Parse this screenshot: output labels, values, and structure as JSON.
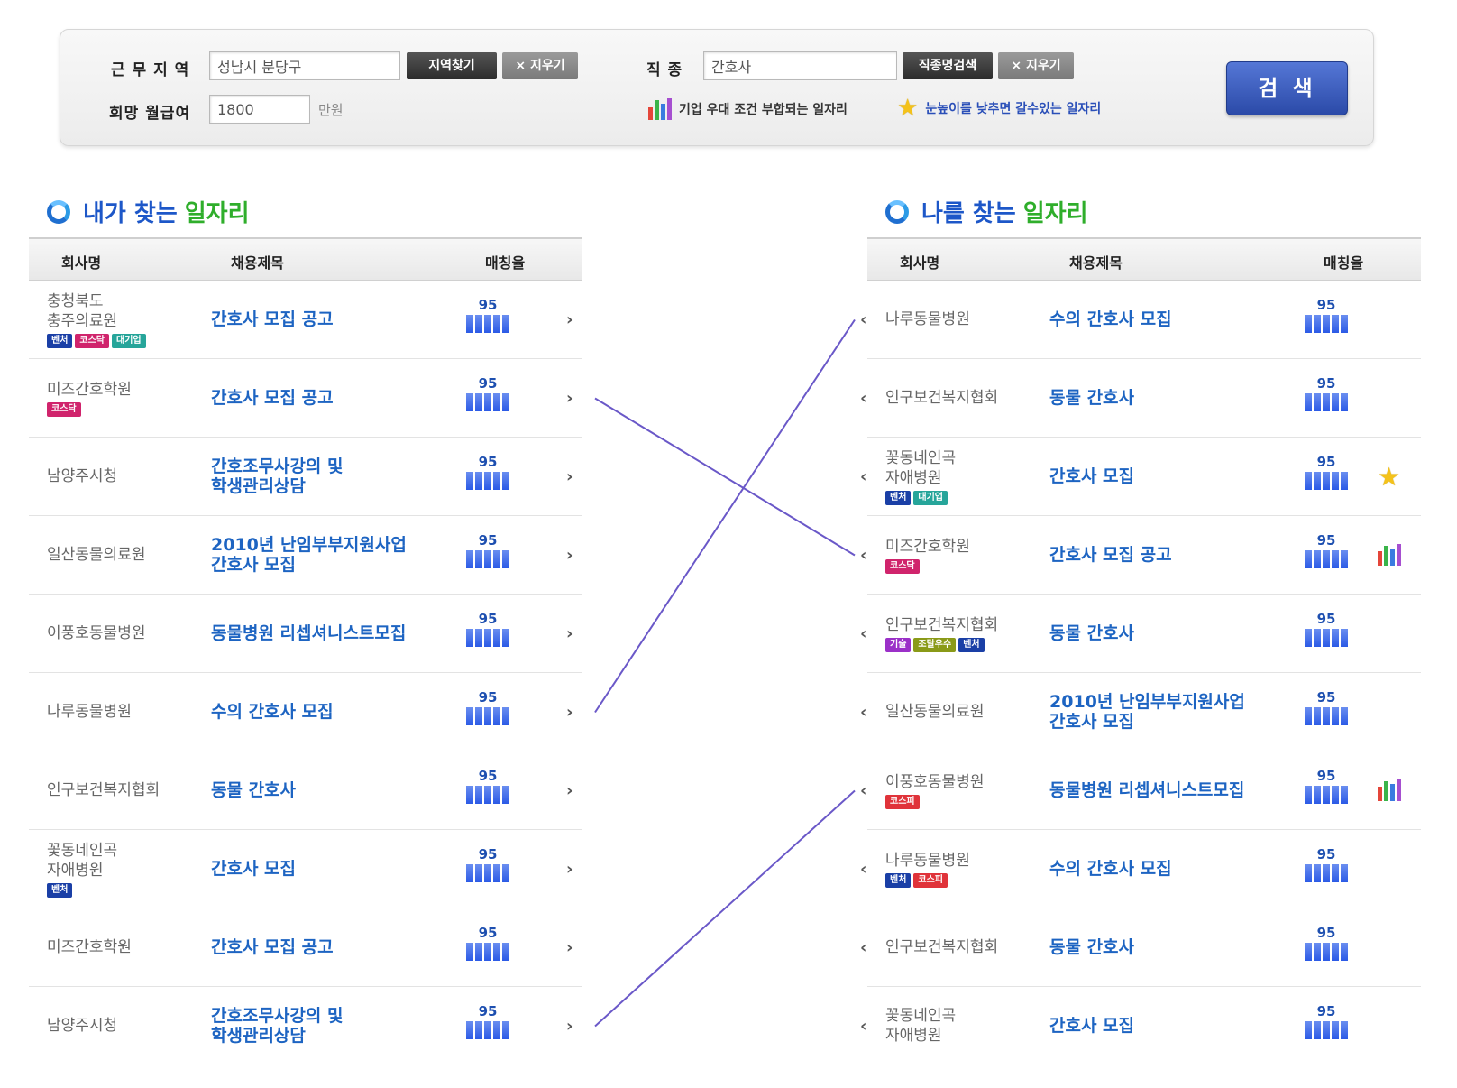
{
  "search": {
    "region_label": "근 무 지 역",
    "region_value": "성남시 분당구",
    "region_find_button": "지역찾기",
    "region_clear_button": "× 지우기",
    "job_label": "직 종",
    "job_value": "간호사",
    "job_search_button": "직종명검색",
    "job_clear_button": "× 지우기",
    "salary_label": "희망 월급여",
    "salary_value": "1800",
    "salary_unit": "만원",
    "legend_company_fit": "기업 우대 조건 부합되는 일자리",
    "legend_lower_bar": "눈높이를 낮추면 갈수있는 일자리",
    "submit_button": "검 색"
  },
  "columns": {
    "company": "회사명",
    "title": "채용제목",
    "match": "매칭율"
  },
  "left_section": {
    "title_a": "내가 찾는 ",
    "title_b": "일자리",
    "rows": [
      {
        "company": [
          "충청북도",
          "충주의료원"
        ],
        "badges": [
          "벤처",
          "코스닥",
          "대기업"
        ],
        "title": [
          "간호사 모집 공고"
        ],
        "score": "95"
      },
      {
        "company": [
          "미즈간호학원"
        ],
        "badges": [
          "코스닥"
        ],
        "title": [
          "간호사 모집 공고"
        ],
        "score": "95"
      },
      {
        "company": [
          "남양주시청"
        ],
        "badges": [],
        "title": [
          "간호조무사강의 및",
          "학생관리상담"
        ],
        "score": "95"
      },
      {
        "company": [
          "일산동물의료원"
        ],
        "badges": [],
        "title": [
          "2010년 난임부부지원사업",
          "간호사 모집"
        ],
        "score": "95"
      },
      {
        "company": [
          "이풍호동물병원"
        ],
        "badges": [],
        "title": [
          "동물병원 리셉셔니스트모집"
        ],
        "score": "95"
      },
      {
        "company": [
          "나루동물병원"
        ],
        "badges": [],
        "title": [
          "수의 간호사 모집"
        ],
        "score": "95"
      },
      {
        "company": [
          "인구보건복지협회"
        ],
        "badges": [],
        "title": [
          "동물 간호사"
        ],
        "score": "95"
      },
      {
        "company": [
          "꽃동네인곡",
          "자애병원"
        ],
        "badges": [
          "벤처"
        ],
        "title": [
          "간호사 모집"
        ],
        "score": "95"
      },
      {
        "company": [
          "미즈간호학원"
        ],
        "badges": [],
        "title": [
          "간호사 모집 공고"
        ],
        "score": "95"
      },
      {
        "company": [
          "남양주시청"
        ],
        "badges": [],
        "title": [
          "간호조무사강의 및",
          "학생관리상담"
        ],
        "score": "95"
      }
    ]
  },
  "right_section": {
    "title_a": "나를 찾는 ",
    "title_b": "일자리",
    "rows": [
      {
        "company": [
          "나루동물병원"
        ],
        "badges": [],
        "title": [
          "수의 간호사 모집"
        ],
        "score": "95",
        "icon": ""
      },
      {
        "company": [
          "인구보건복지협회"
        ],
        "badges": [],
        "title": [
          "동물 간호사"
        ],
        "score": "95",
        "icon": ""
      },
      {
        "company": [
          "꽃동네인곡",
          "자애병원"
        ],
        "badges": [
          "벤처",
          "대기업"
        ],
        "title": [
          "간호사 모집"
        ],
        "score": "95",
        "icon": "star-icon"
      },
      {
        "company": [
          "미즈간호학원"
        ],
        "badges": [
          "코스닥"
        ],
        "title": [
          "간호사 모집 공고"
        ],
        "score": "95",
        "icon": "bar-chart-icon"
      },
      {
        "company": [
          "인구보건복지협회"
        ],
        "badges": [
          "기술",
          "조달우수",
          "벤처"
        ],
        "title": [
          "동물 간호사"
        ],
        "score": "95",
        "icon": ""
      },
      {
        "company": [
          "일산동물의료원"
        ],
        "badges": [],
        "title": [
          "2010년 난임부부지원사업",
          "간호사 모집"
        ],
        "score": "95",
        "icon": ""
      },
      {
        "company": [
          "이풍호동물병원"
        ],
        "badges": [
          "코스피"
        ],
        "title": [
          "동물병원 리셉셔니스트모집"
        ],
        "score": "95",
        "icon": "bar-chart-icon"
      },
      {
        "company": [
          "나루동물병원"
        ],
        "badges": [
          "벤처",
          "코스피"
        ],
        "title": [
          "수의 간호사 모집"
        ],
        "score": "95",
        "icon": ""
      },
      {
        "company": [
          "인구보건복지협회"
        ],
        "badges": [],
        "title": [
          "동물 간호사"
        ],
        "score": "95",
        "icon": ""
      },
      {
        "company": [
          "꽃동네인곡",
          "자애병원"
        ],
        "badges": [],
        "title": [
          "간호사 모집"
        ],
        "score": "95",
        "icon": ""
      }
    ]
  },
  "badge_colors": {
    "벤처": "#1a3fa6",
    "코스닥": "#d0246c",
    "대기업": "#26a59a",
    "기술": "#9b30c8",
    "조달우수": "#8a9a18",
    "코스피": "#e0333a"
  },
  "connections": [
    {
      "left_row": 1,
      "right_row": 3
    },
    {
      "left_row": 5,
      "right_row": 0
    },
    {
      "left_row": 9,
      "right_row": 6
    }
  ]
}
